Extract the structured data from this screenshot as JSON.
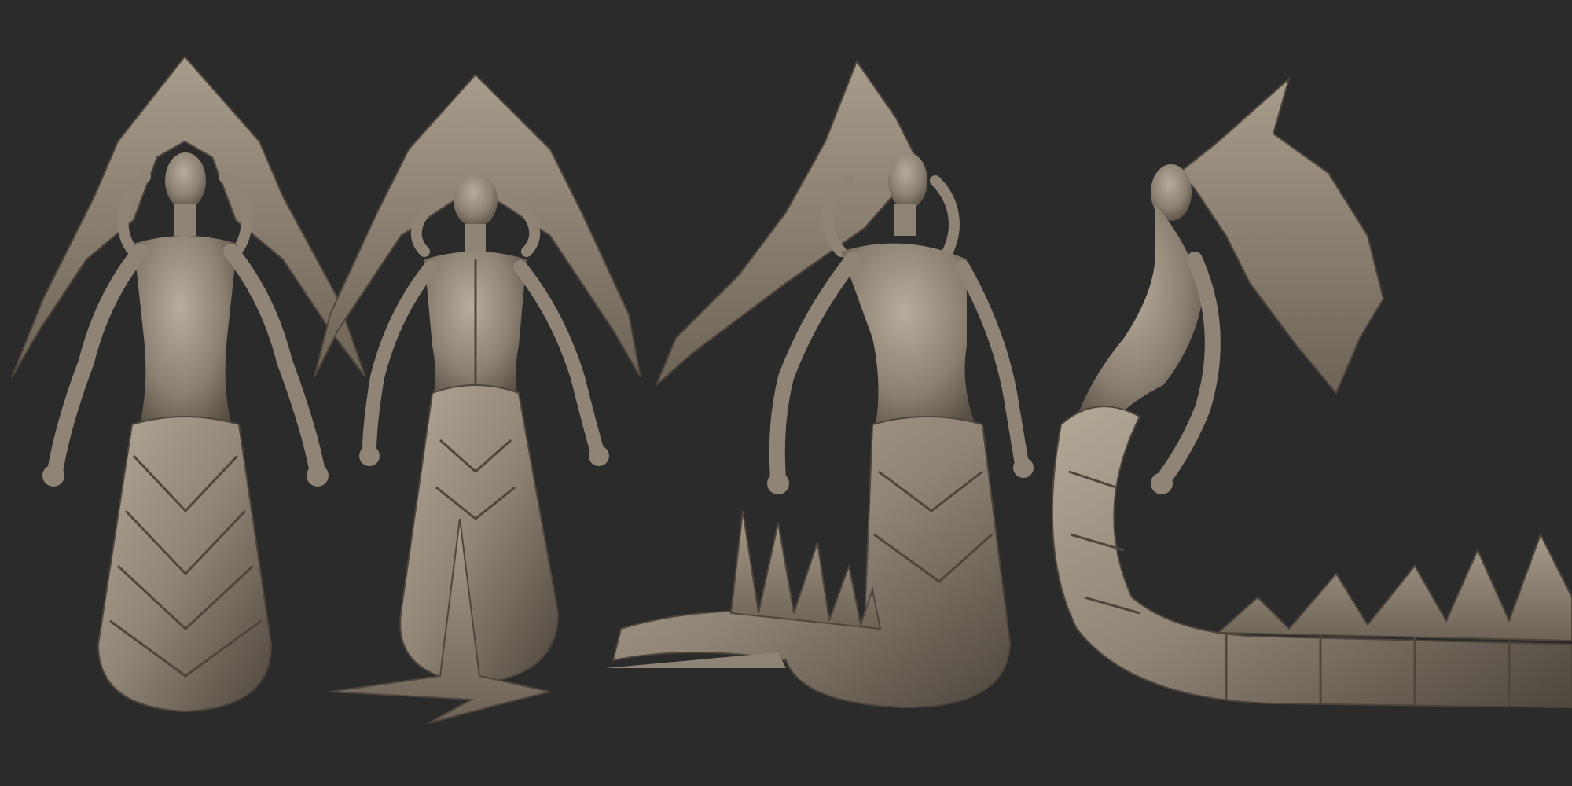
{
  "canvas": {
    "background": "#2b2b2b",
    "clay_color": "#8f8475",
    "clay_highlight": "#b4a897",
    "clay_shadow": "#4e463d"
  },
  "views": [
    {
      "id": "front",
      "label": ""
    },
    {
      "id": "back",
      "label": ""
    },
    {
      "id": "three-quarter",
      "label": ""
    },
    {
      "id": "side",
      "label": ""
    }
  ]
}
